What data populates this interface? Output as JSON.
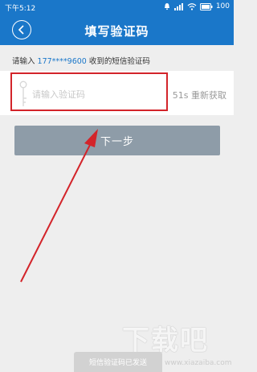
{
  "status_bar": {
    "time": "下午5:12",
    "battery": "100"
  },
  "header": {
    "title": "填写验证码",
    "back_icon": "chevron-left-icon"
  },
  "hint": {
    "prefix": "请输入 ",
    "phone": "177****9600",
    "suffix": " 收到的短信验证码"
  },
  "code_field": {
    "placeholder": "请输入验证码",
    "value": "",
    "icon": "key-icon"
  },
  "resend": {
    "label": "51s 重新获取"
  },
  "next_button": {
    "label": "下一步"
  },
  "toast": {
    "text": "短信验证码已发送"
  },
  "watermark": {
    "logo": "下载吧",
    "url": "www.xiazaiba.com"
  },
  "colors": {
    "primary": "#1a77c9",
    "highlight": "#d3242a",
    "button": "#8e9ca8",
    "background": "#eeeeee"
  }
}
